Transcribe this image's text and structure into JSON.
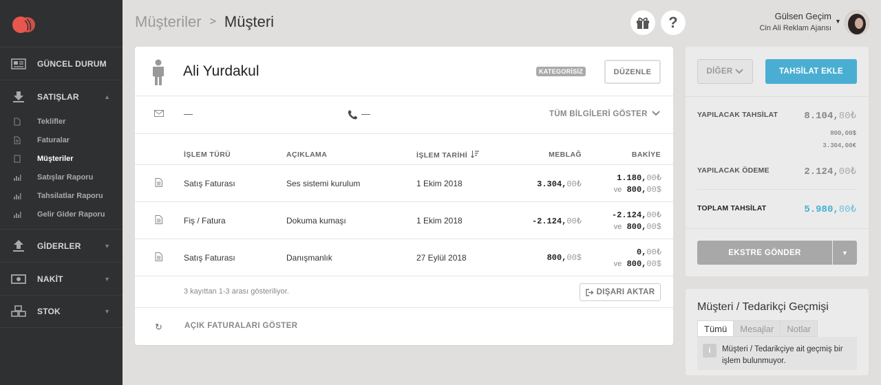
{
  "sidebar": {
    "sections": [
      {
        "label": "GÜNCEL DURUM",
        "icon": "dashboard-icon"
      },
      {
        "label": "SATIŞLAR",
        "icon": "sales-download-icon"
      },
      {
        "label": "GİDERLER",
        "icon": "expenses-upload-icon"
      },
      {
        "label": "NAKİT",
        "icon": "cash-icon"
      },
      {
        "label": "STOK",
        "icon": "stock-boxes-icon"
      }
    ],
    "sales_items": [
      {
        "label": "Teklifler",
        "icon": "document-icon"
      },
      {
        "label": "Faturalar",
        "icon": "document-icon"
      },
      {
        "label": "Müşteriler",
        "icon": "customers-icon"
      },
      {
        "label": "Satışlar Raporu",
        "icon": "bar-chart-icon"
      },
      {
        "label": "Tahsilatlar Raporu",
        "icon": "bar-chart-icon"
      },
      {
        "label": "Gelir Gider Raporu",
        "icon": "bar-chart-icon"
      }
    ]
  },
  "header": {
    "breadcrumb_parent": "Müşteriler",
    "breadcrumb_separator": ">",
    "breadcrumb_current": "Müşteri",
    "user_name": "Gülsen Geçim",
    "company": "Cin Ali Reklam Ajansı"
  },
  "customer": {
    "name": "Ali Yurdakul",
    "category_badge": "KATEGORİSİZ",
    "edit_label": "DÜZENLE",
    "email": "—",
    "phone": "—",
    "show_all_label": "TÜM BİLGİLERİ GÖSTER"
  },
  "table": {
    "headers": {
      "type": "İŞLEM TÜRÜ",
      "description": "AÇIKLAMA",
      "date": "İŞLEM TARİHİ",
      "amount": "MEBLAĞ",
      "balance": "BAKİYE"
    },
    "rows": [
      {
        "type": "Satış Faturası",
        "description": "Ses sistemi kurulum",
        "date": "1 Ekim 2018",
        "amount_int": "3.304,",
        "amount_dec": "00₺",
        "bal1_int": "1.180,",
        "bal1_dec": "00₺",
        "bal2_prefix": "ve",
        "bal2_int": "800,",
        "bal2_dec": "00$"
      },
      {
        "type": "Fiş / Fatura",
        "description": "Dokuma kumaşı",
        "date": "1 Ekim 2018",
        "amount_int": "-2.124,",
        "amount_dec": "00₺",
        "bal1_int": "-2.124,",
        "bal1_dec": "00₺",
        "bal2_prefix": "ve",
        "bal2_int": "800,",
        "bal2_dec": "00$"
      },
      {
        "type": "Satış Faturası",
        "description": "Danışmanlık",
        "date": "27 Eylül 2018",
        "amount_int": "800,",
        "amount_dec": "00$",
        "bal1_int": "0,",
        "bal1_dec": "00₺",
        "bal2_prefix": "ve",
        "bal2_int": "800,",
        "bal2_dec": "00$"
      }
    ],
    "footer_text": "3 kayıttan 1-3 arası gösteriliyor.",
    "export_label": "DIŞARI AKTAR",
    "open_invoices_label": "AÇIK FATURALARI GÖSTER"
  },
  "summary": {
    "other_label": "DİĞER",
    "add_collection_label": "TAHSİLAT EKLE",
    "to_collect_label": "YAPILACAK TAHSİLAT",
    "to_collect_int": "8.104,",
    "to_collect_dec": "80₺",
    "to_collect_sub1": "800,00$",
    "to_collect_sub2": "3.304,00€",
    "to_pay_label": "YAPILACAK ÖDEME",
    "to_pay_int": "2.124,",
    "to_pay_dec": "00₺",
    "total_label": "TOPLAM TAHSİLAT",
    "total_int": "5.980,",
    "total_dec": "80₺",
    "statement_label": "EKSTRE GÖNDER"
  },
  "history": {
    "title": "Müşteri / Tedarikçi Geçmişi",
    "tabs": [
      "Tümü",
      "Mesajlar",
      "Notlar"
    ],
    "empty_text": "Müşteri / Tedarikçiye ait geçmiş bir işlem bulunmuyor."
  },
  "colors": {
    "sidebar_bg": "#2f3032",
    "accent_blue": "#4aaed3",
    "logo_red": "#e8574e",
    "page_bg": "#e0dfde"
  }
}
